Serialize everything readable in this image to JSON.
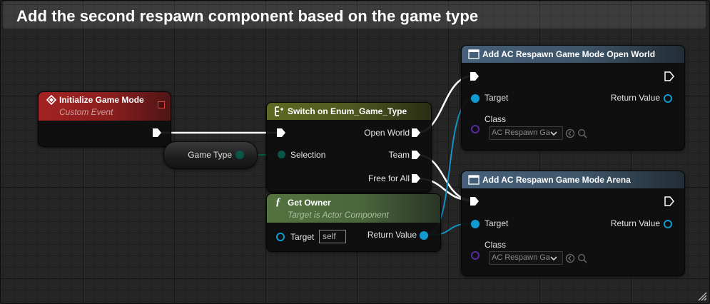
{
  "comment": {
    "title": "Add the second respawn component based on the game type"
  },
  "colors": {
    "event_header": "#9a1f1f",
    "switch_header": "#5c6620",
    "function_header": "#4c6b3d",
    "add_component_header": "#3d5568",
    "exec_wire": "#ffffff",
    "object_wire": "#119bd0",
    "enum_wire": "#0a5448",
    "class_pin": "#5a2aa0"
  },
  "event_node": {
    "icon": "event-diamond-icon",
    "title": "Initialize Game Mode",
    "subtitle": "Custom Event"
  },
  "game_type_node": {
    "label": "Game Type"
  },
  "switch_node": {
    "icon": "switch-enum-icon",
    "title": "Switch on Enum_Game_Type",
    "selection_label": "Selection",
    "outputs": [
      "Open World",
      "Team",
      "Free for All"
    ]
  },
  "get_owner_node": {
    "icon": "function-f-icon",
    "title": "Get Owner",
    "subtitle": "Target is Actor Component",
    "target_label": "Target",
    "target_value": "self",
    "return_label": "Return Value"
  },
  "add_open_world": {
    "icon": "component-icon",
    "title": "Add AC Respawn Game Mode Open World",
    "target_label": "Target",
    "return_label": "Return Value",
    "class_label": "Class",
    "class_value": "AC Respawn Ga"
  },
  "add_arena": {
    "icon": "component-icon",
    "title": "Add AC Respawn Game Mode Arena",
    "target_label": "Target",
    "return_label": "Return Value",
    "class_label": "Class",
    "class_value": "AC Respawn Ga"
  }
}
